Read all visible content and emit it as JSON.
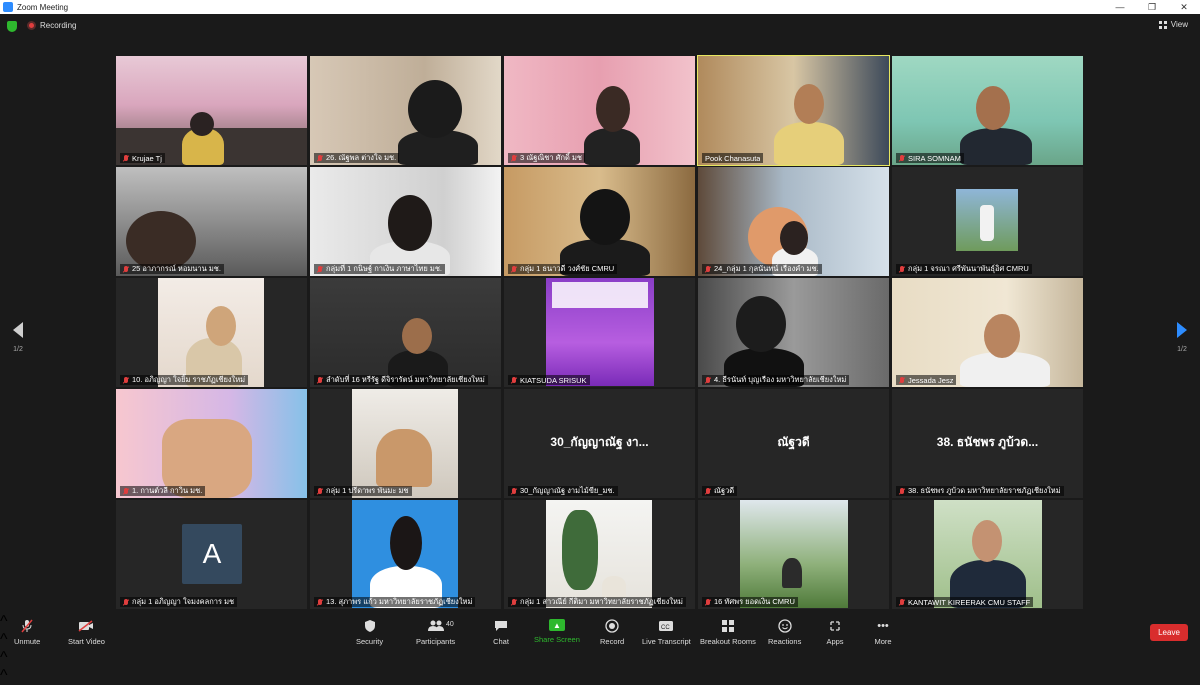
{
  "window": {
    "title": "Zoom Meeting",
    "controls": [
      "—",
      "❐",
      "✕"
    ]
  },
  "top": {
    "recording": "Recording",
    "view": "View"
  },
  "pager": {
    "left": "1/2",
    "right": "1/2"
  },
  "tiles": [
    {
      "name": "Krujae Tj"
    },
    {
      "name": "26. ณัฐพล ต่างใจ มช."
    },
    {
      "name": "3 ณัฐณิชา ศักดิ์ มช"
    },
    {
      "name": "Pook Chanasuta"
    },
    {
      "name": "SIRA SOMNAM"
    },
    {
      "name": "25 อาภากรณ์ หอมนาน มช."
    },
    {
      "name": "กลุ่มที่ 1 กนิษฐ์ กาเงิน ภาษาไทย มช."
    },
    {
      "name": "กลุ่ม 1 ธนาวดี วงศ์ชัย CMRU"
    },
    {
      "name": "24_กลุ่ม 1 กุลนันทน์ เรืองคำ มช."
    },
    {
      "name": "กลุ่ม 1 จรณา ศรีพันนาพันธุ์อิศ CMRU"
    },
    {
      "name": "10. อภิญญา ใจยิ้ม ราชภัฏเชียงใหม่"
    },
    {
      "name": "ลำดับที่ 16 หรีรัฐ ดีจิรารัตน์ มหาวิทยาลัยเชียงใหม่"
    },
    {
      "name": "KIATSUDA SRISUK"
    },
    {
      "name": "4. ธีรนันท์ บุญเรือง มหาวิทยาลัยเชียงใหม่"
    },
    {
      "name": "Jessada Jesz"
    },
    {
      "name": "1. กานต์วลี กาวิน มช."
    },
    {
      "name": "กลุ่ม 1 ปรีดาพร พันมะ มช"
    },
    {
      "name": "30_กัญญาณัฐ งามไม้ขีย_มช.",
      "display": "30_กัญญาณัฐ งา..."
    },
    {
      "name": "ณัฐวดี",
      "display": "ณัฐวดี"
    },
    {
      "name": "38. ธนัชพร ภูบ้วด มหาวิทยาลัยราชภัฏเชียงใหม่",
      "display": "38. ธนัชพร ภูบ้วด..."
    },
    {
      "name": "กลุ่ม 1 อภิญญา ใจมงคลการ มช",
      "avatar": "A"
    },
    {
      "name": "13. สุภาพร แก้ว มหาวิทยาลัยราชภัฏเชียงใหม่"
    },
    {
      "name": "กลุ่ม 1 สาวณีย์ กีติมา มหาวิทยาลัยราชภัฏเชียงใหม่"
    },
    {
      "name": "16 ทัศพร ยอดเงิน CMRU"
    },
    {
      "name": "KANTAWIT KIREERAK CMU STAFF"
    }
  ],
  "toolbar": {
    "unmute": "Unmute",
    "start_video": "Start Video",
    "security": "Security",
    "participants": "Participants",
    "participants_count": "40",
    "chat": "Chat",
    "share_screen": "Share Screen",
    "record": "Record",
    "live_transcript": "Live Transcript",
    "breakout_rooms": "Breakout Rooms",
    "reactions": "Reactions",
    "apps": "Apps",
    "more": "More",
    "leave": "Leave"
  },
  "colors": {
    "active_speaker": "#e7e760",
    "share": "#2eb82e",
    "leave": "#d92d2d",
    "muted_mic": "#e03e3e"
  }
}
